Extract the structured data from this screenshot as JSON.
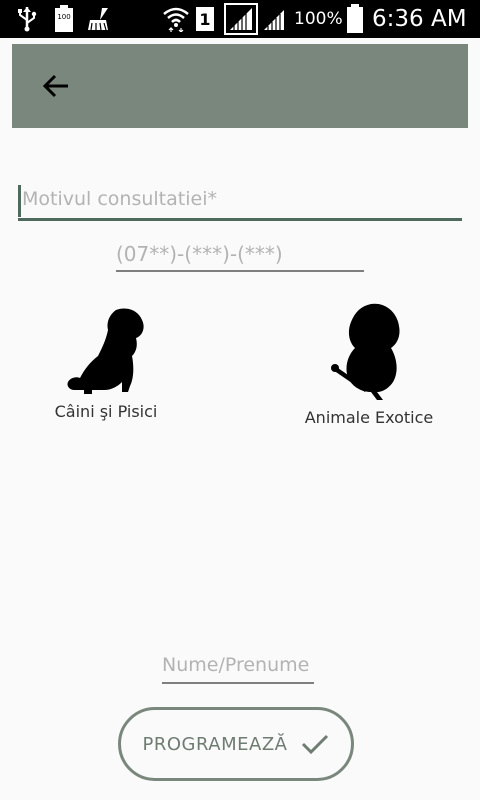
{
  "status_bar": {
    "battery_small": "100",
    "sim_slot": "1",
    "battery_percent": "100%",
    "time": "6:36 AM",
    "icons": [
      "usb-icon",
      "battery-small-icon",
      "cleaner-icon",
      "wifi-icon",
      "sim-icon",
      "signal-icon",
      "battery-icon"
    ]
  },
  "toolbar": {
    "back_icon": "arrow-left-icon",
    "color": "#7a877d"
  },
  "form": {
    "reason_placeholder": "Motivul consultatiei*",
    "phone_placeholder": "(07**)-(***)-(***)",
    "name_placeholder": "Nume/Prenume"
  },
  "pet_types": [
    {
      "label": "Câini şi Pisici",
      "icon": "dog-silhouette-icon"
    },
    {
      "label": "Animale Exotice",
      "icon": "parrot-silhouette-icon"
    }
  ],
  "submit": {
    "label": "PROGRAMEAZĂ",
    "icon": "check-icon"
  },
  "colors": {
    "accent": "#4e6a5c",
    "toolbar": "#7a877d",
    "placeholder": "#b3b3b3"
  }
}
